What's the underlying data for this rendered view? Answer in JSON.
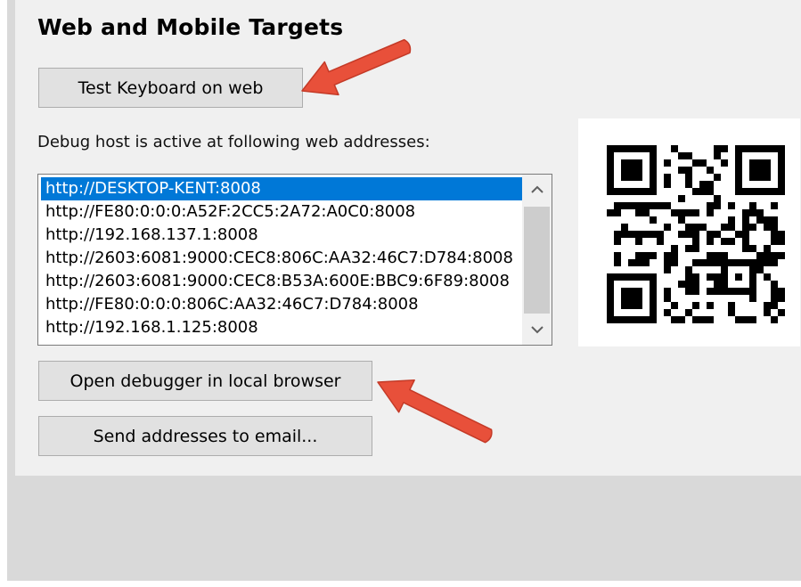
{
  "section": {
    "title": "Web and Mobile Targets"
  },
  "buttons": {
    "test_keyboard": "Test Keyboard on web",
    "open_debugger": "Open debugger in local browser",
    "send_email": "Send addresses to email..."
  },
  "debug_label": "Debug host is active at following web addresses:",
  "addresses": [
    "http://DESKTOP-KENT:8008",
    "http://FE80:0:0:0:A52F:2CC5:2A72:A0C0:8008",
    "http://192.168.137.1:8008",
    "http://2603:6081:9000:CEC8:806C:AA32:46C7:D784:8008",
    "http://2603:6081:9000:CEC8:B53A:600E:BBC9:6F89:8008",
    "http://FE80:0:0:0:806C:AA32:46C7:D784:8008",
    "http://192.168.1.125:8008"
  ],
  "selected_index": 0,
  "icons": {
    "scroll_up": "chevron-up-icon",
    "scroll_down": "chevron-down-icon",
    "qr": "qr-code-icon",
    "annotation": "red-arrow-icon"
  },
  "colors": {
    "selection": "#0078d7",
    "panel_bg": "#f0f0f0",
    "button_bg": "#e1e1e1",
    "annotation_arrow": "#e8503a"
  }
}
